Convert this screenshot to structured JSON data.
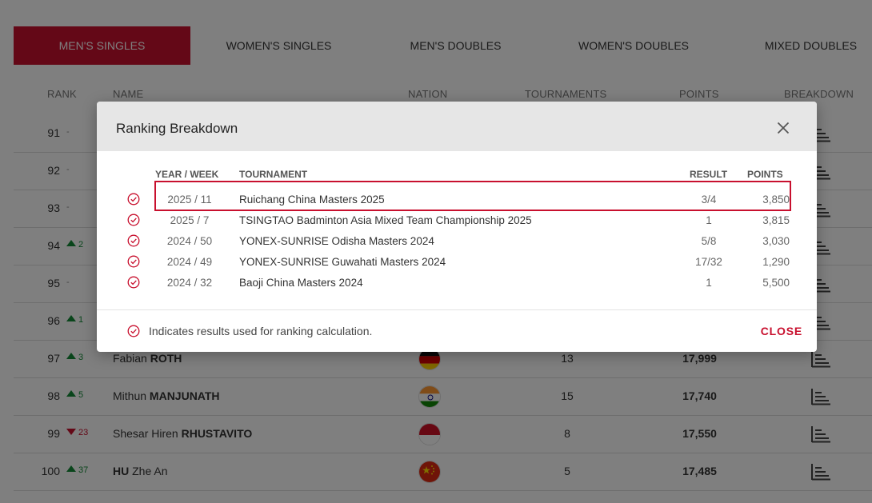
{
  "tabs": [
    "MEN'S SINGLES",
    "WOMEN'S SINGLES",
    "MEN'S DOUBLES",
    "WOMEN'S DOUBLES",
    "MIXED DOUBLES"
  ],
  "active_tab": "MEN'S SINGLES",
  "table_headers": {
    "rank": "RANK",
    "name": "NAME",
    "nation": "NATION",
    "tournaments": "TOURNAMENTS",
    "points": "POINTS",
    "breakdown": "BREAKDOWN"
  },
  "colors": {
    "accent": "#c8102e",
    "up": "#138a36",
    "down": "#c8102e"
  },
  "rows": [
    {
      "rank": "91",
      "move": "-",
      "dir": "same",
      "first": "",
      "last": "",
      "tourn": "",
      "points": ""
    },
    {
      "rank": "92",
      "move": "-",
      "dir": "same",
      "first": "",
      "last": "",
      "tourn": "",
      "points": ""
    },
    {
      "rank": "93",
      "move": "-",
      "dir": "same",
      "first": "",
      "last": "",
      "tourn": "",
      "points": ""
    },
    {
      "rank": "94",
      "move": "2",
      "dir": "up",
      "first": "",
      "last": "",
      "tourn": "",
      "points": ""
    },
    {
      "rank": "95",
      "move": "-",
      "dir": "same",
      "first": "",
      "last": "",
      "tourn": "",
      "points": ""
    },
    {
      "rank": "96",
      "move": "1",
      "dir": "up",
      "first": "",
      "last": "",
      "tourn": "",
      "points": ""
    },
    {
      "rank": "97",
      "move": "3",
      "dir": "up",
      "first": "Fabian",
      "last": "ROTH",
      "tourn": "13",
      "points": "17,999",
      "flag": "germany"
    },
    {
      "rank": "98",
      "move": "5",
      "dir": "up",
      "first": "Mithun",
      "last": "MANJUNATH",
      "tourn": "15",
      "points": "17,740",
      "flag": "india"
    },
    {
      "rank": "99",
      "move": "23",
      "dir": "down",
      "first": "Shesar Hiren",
      "last": "RHUSTAVITO",
      "tourn": "8",
      "points": "17,550",
      "flag": "indonesia"
    },
    {
      "rank": "100",
      "move": "37",
      "dir": "up",
      "first": "Zhe An",
      "last": "HU",
      "last_first": true,
      "tourn": "5",
      "points": "17,485",
      "flag": "china"
    }
  ],
  "modal": {
    "title": "Ranking Breakdown",
    "headers": {
      "year_week": "YEAR / WEEK",
      "tournament": "TOURNAMENT",
      "result": "RESULT",
      "points": "POINTS"
    },
    "entries": [
      {
        "yw": "2025 / 11",
        "tournament": "Ruichang China Masters 2025",
        "result": "3/4",
        "points": "3,850"
      },
      {
        "yw": "2025 / 7",
        "tournament": "TSINGTAO Badminton Asia Mixed Team Championship 2025",
        "result": "1",
        "points": "3,815"
      },
      {
        "yw": "2024 / 50",
        "tournament": "YONEX-SUNRISE Odisha Masters 2024",
        "result": "5/8",
        "points": "3,030"
      },
      {
        "yw": "2024 / 49",
        "tournament": "YONEX-SUNRISE Guwahati Masters 2024",
        "result": "17/32",
        "points": "1,290"
      },
      {
        "yw": "2024 / 32",
        "tournament": "Baoji China Masters 2024",
        "result": "1",
        "points": "5,500"
      }
    ],
    "footer_note": "Indicates results used for ranking calculation.",
    "close_label": "CLOSE"
  }
}
